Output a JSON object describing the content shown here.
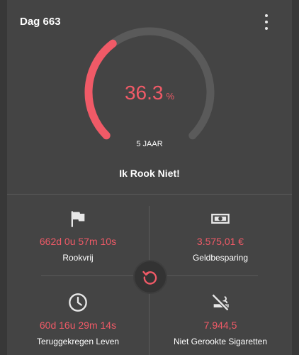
{
  "header": {
    "title": "Dag 663"
  },
  "gauge": {
    "value": "36.3",
    "unit": "%",
    "progress": 0.363,
    "label": "5 JAAR",
    "color": "#f05a67",
    "track_color": "#5a5a5a"
  },
  "headline": "Ik Rook Niet!",
  "stats": [
    {
      "icon": "flag-icon",
      "value": "662d 0u 57m 10s",
      "label": "Rookvrij"
    },
    {
      "icon": "money-icon",
      "value": "3.575,01 €",
      "label": "Geldbesparing"
    },
    {
      "icon": "clock-icon",
      "value": "60d 16u 29m 14s",
      "label": "Teruggekregen Leven"
    },
    {
      "icon": "no-smoking-icon",
      "value": "7.944,5",
      "label": "Niet Gerookte Sigaretten"
    }
  ],
  "colors": {
    "accent": "#f05a67",
    "card": "#444444",
    "background": "#383838"
  }
}
